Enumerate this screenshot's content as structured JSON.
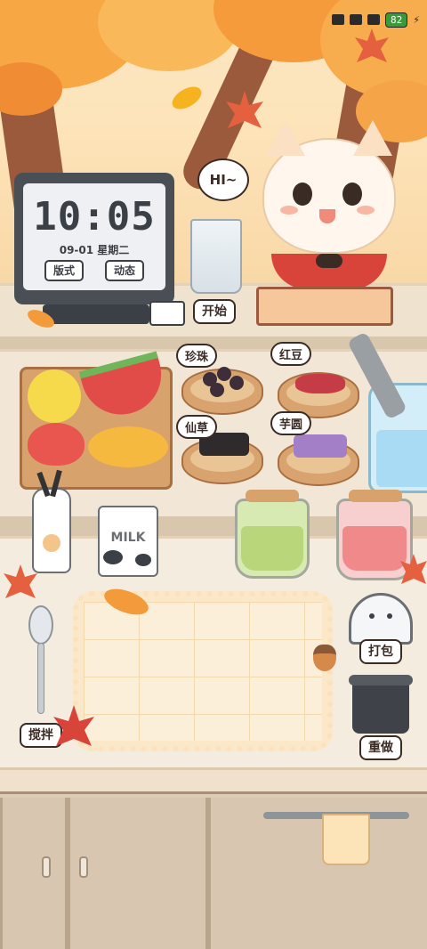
{
  "status_bar": {
    "battery": "82",
    "icons": [
      "phone-icon",
      "x-icon",
      "signal-icon",
      "battery-icon",
      "lightning-icon"
    ]
  },
  "speech_bubble": "HI~",
  "clock": {
    "time": "10:05",
    "date": "09-01  星期二",
    "style_button": "版式",
    "motion_button": "动态"
  },
  "labels": {
    "start": "开始",
    "pearls": "珍珠",
    "red_beans": "红豆",
    "grass_jelly": "仙草",
    "taro_balls": "芋圆",
    "stir": "搅拌",
    "pack": "打包",
    "redo": "重做"
  },
  "milk_carton": "MILK",
  "colors": {
    "leaf_orange": "#f39a3a",
    "leaf_red": "#e4603e",
    "trunk": "#9b5a3c",
    "green_tea": "#b9d67a",
    "red_tea": "#f08a8a",
    "ice": "#a9dcf4"
  }
}
